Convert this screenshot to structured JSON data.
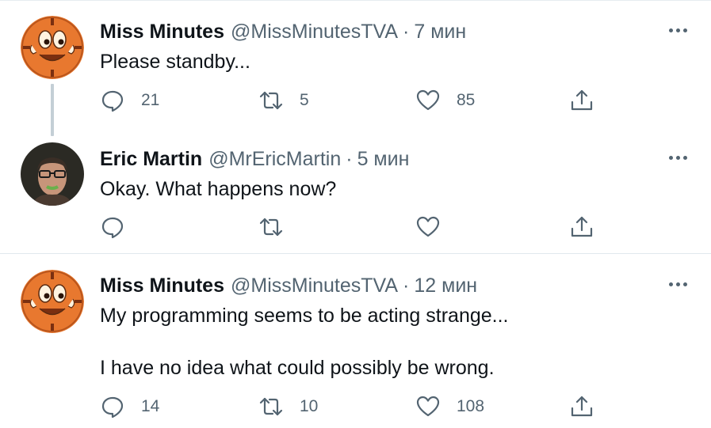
{
  "tweets": [
    {
      "name": "Miss Minutes",
      "handle": "@MissMinutesTVA",
      "separator": "·",
      "time": "7 мин",
      "text": "Please standby...",
      "replies": "21",
      "retweets": "5",
      "likes": "85"
    },
    {
      "name": "Eric Martin",
      "handle": "@MrEricMartin",
      "separator": "·",
      "time": "5 мин",
      "text": "Okay. What happens now?",
      "replies": "",
      "retweets": "",
      "likes": ""
    },
    {
      "name": "Miss Minutes",
      "handle": "@MissMinutesTVA",
      "separator": "·",
      "time": "12 мин",
      "text": "My programming seems to be acting strange...\n\nI have no idea what could possibly be wrong.",
      "replies": "14",
      "retweets": "10",
      "likes": "108"
    }
  ],
  "icons": {
    "reply": "reply-icon",
    "retweet": "retweet-icon",
    "like": "heart-icon",
    "share": "share-icon",
    "more": "more-icon"
  },
  "colors": {
    "text": "#0f1419",
    "secondary": "#536471",
    "divider": "#e1e8ed",
    "thread_line": "#c4cfd6",
    "clock_face": "#e8782f"
  }
}
